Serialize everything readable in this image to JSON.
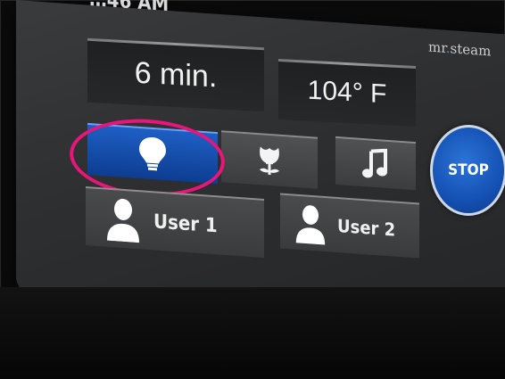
{
  "brand": {
    "name_part1": "mr",
    "dot": ".",
    "name_part2": "steam"
  },
  "display": {
    "clock_partial": "…46 AM",
    "timer": "6 min.",
    "temperature": "104° F"
  },
  "buttons": {
    "light": {
      "icon": "light-bulb-icon",
      "active": true
    },
    "aroma": {
      "icon": "tulip-icon"
    },
    "music": {
      "icon": "music-note-icon"
    },
    "stop": {
      "label": "STOP"
    }
  },
  "users": [
    {
      "label": "User 1",
      "icon": "person-icon"
    },
    {
      "label": "User 2",
      "icon": "person-icon"
    }
  ],
  "annotation": {
    "color": "#e8157b",
    "target": "light"
  },
  "colors": {
    "active_blue": "#1451b3",
    "highlight": "#e8157b"
  }
}
